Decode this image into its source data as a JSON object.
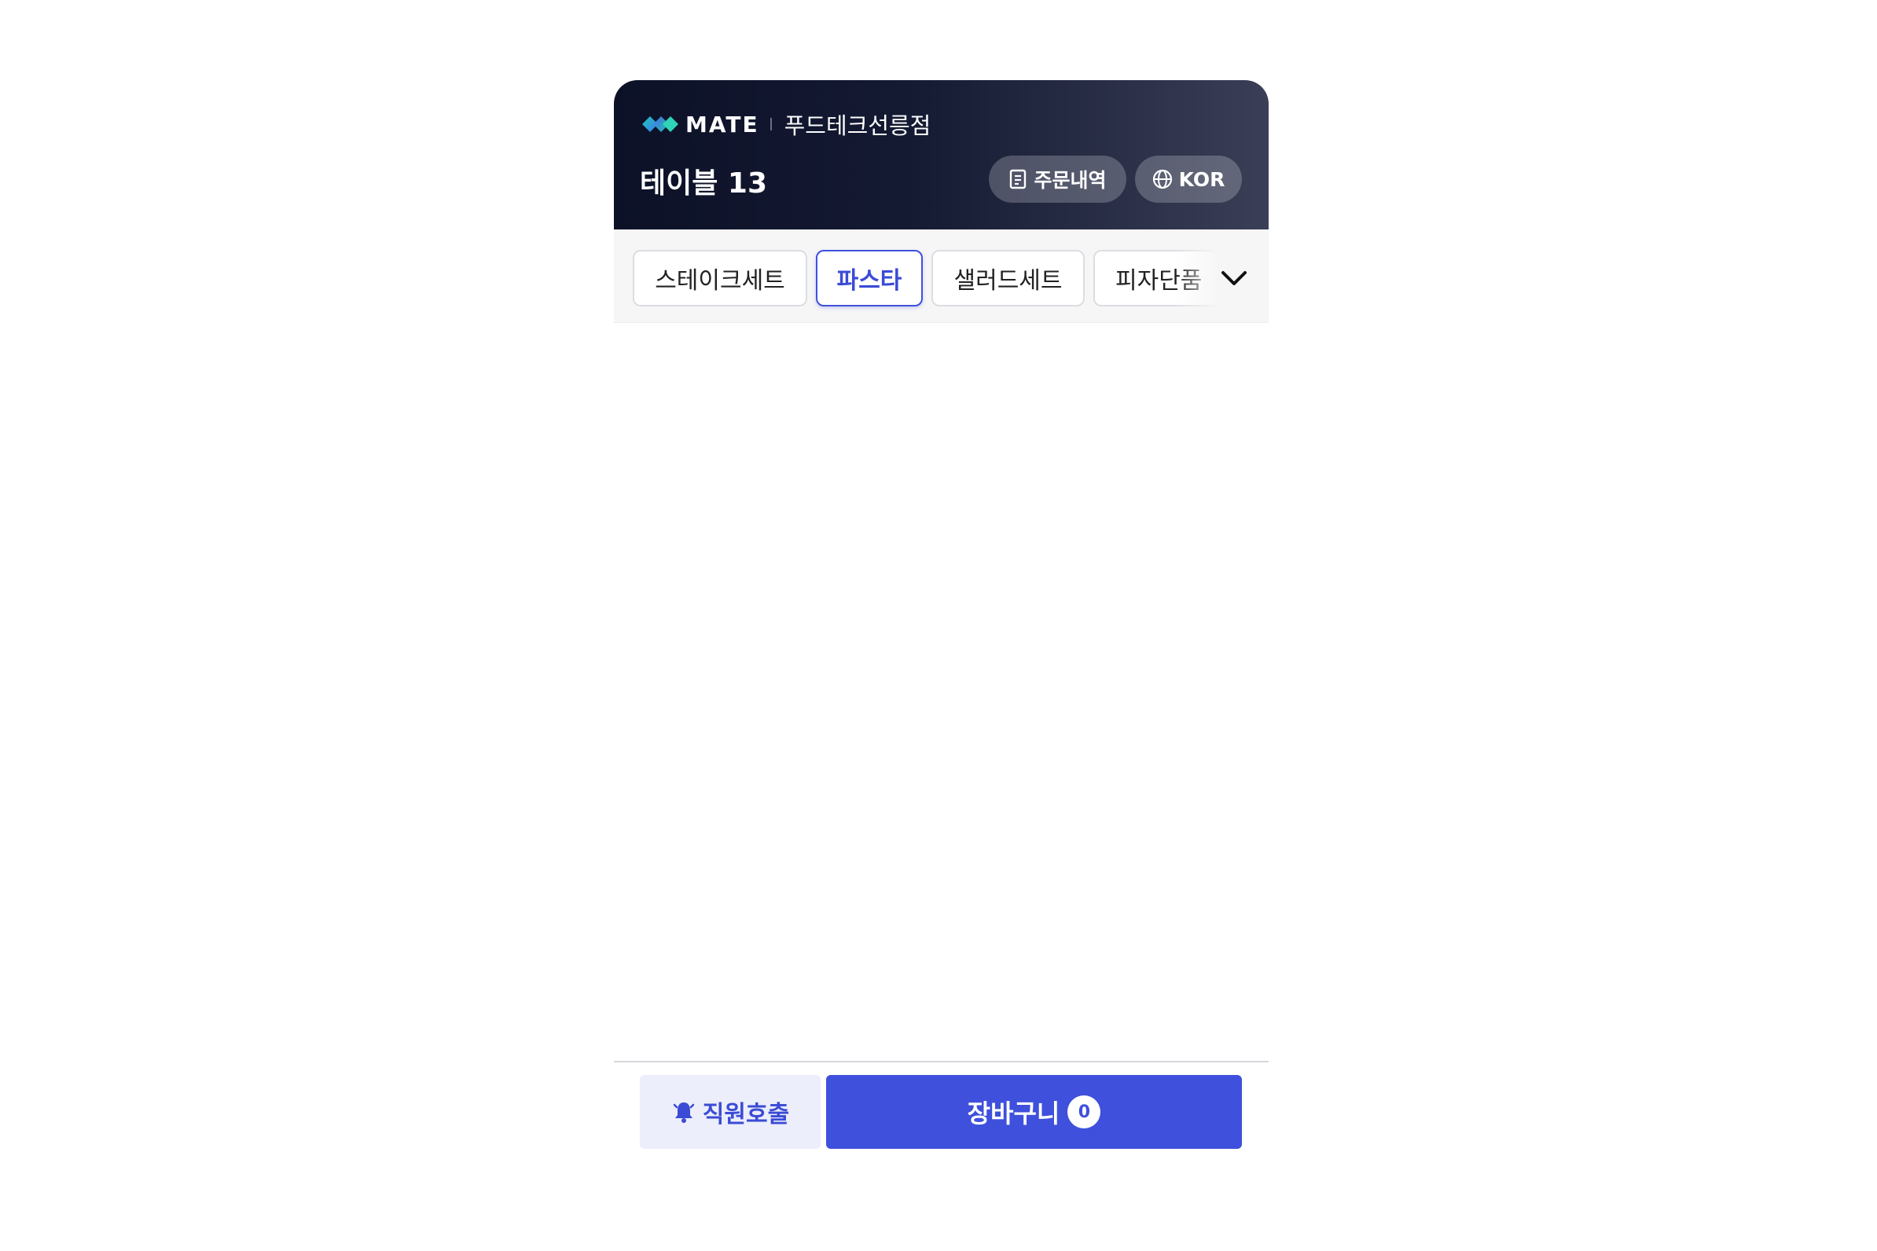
{
  "header": {
    "brand": "MATE",
    "store_name": "푸드테크선릉점",
    "table_label": "테이블 13",
    "orders_button": "주문내역",
    "language_button": "KOR"
  },
  "categories": {
    "tabs": [
      "스테이크세트",
      "파스타",
      "샐러드세트",
      "피자단품"
    ],
    "active_index": 1
  },
  "footer": {
    "call_staff": "직원호출",
    "cart_label": "장바구니",
    "cart_count": "0"
  },
  "icons": {
    "orders": "receipt-icon",
    "language": "globe-icon",
    "expand": "chevron-down-icon",
    "call": "bell-icon"
  },
  "colors": {
    "accent": "#3f50dc",
    "header_dark": "#0c1127",
    "call_bg": "#eceefb"
  }
}
